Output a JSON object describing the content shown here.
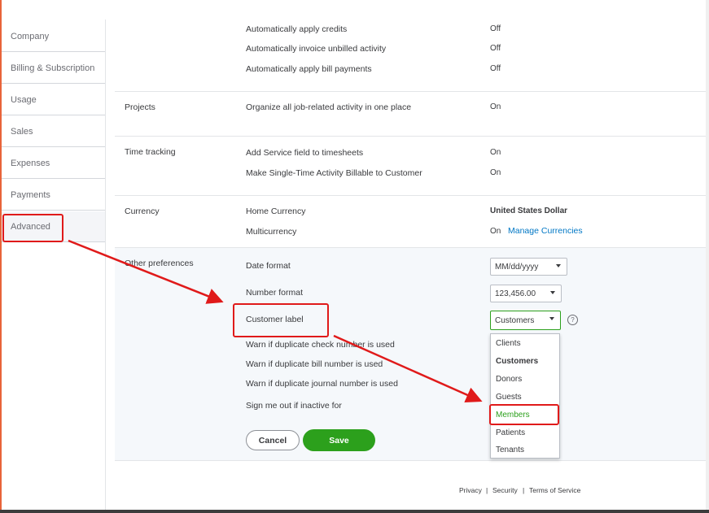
{
  "sidebar": {
    "items": [
      {
        "label": "Company"
      },
      {
        "label": "Billing & Subscription"
      },
      {
        "label": "Usage"
      },
      {
        "label": "Sales"
      },
      {
        "label": "Expenses"
      },
      {
        "label": "Payments"
      },
      {
        "label": "Advanced"
      }
    ]
  },
  "automation": {
    "rows": [
      {
        "label": "Automatically apply credits",
        "value": "Off"
      },
      {
        "label": "Automatically invoice unbilled activity",
        "value": "Off"
      },
      {
        "label": "Automatically apply bill payments",
        "value": "Off"
      }
    ]
  },
  "projects": {
    "title": "Projects",
    "rows": [
      {
        "label": "Organize all job-related activity in one place",
        "value": "On"
      }
    ]
  },
  "time_tracking": {
    "title": "Time tracking",
    "rows": [
      {
        "label": "Add Service field to timesheets",
        "value": "On"
      },
      {
        "label": "Make Single-Time Activity Billable to Customer",
        "value": "On"
      }
    ]
  },
  "currency": {
    "title": "Currency",
    "home_label": "Home Currency",
    "home_value": "United States Dollar",
    "multi_label": "Multicurrency",
    "multi_value": "On",
    "manage_link": "Manage Currencies"
  },
  "other": {
    "title": "Other preferences",
    "date_format_label": "Date format",
    "date_format_value": "MM/dd/yyyy",
    "number_format_label": "Number format",
    "number_format_value": "123,456.00",
    "customer_label_label": "Customer label",
    "customer_label_value": "Customers",
    "help_icon": "?",
    "warn_check": "Warn if duplicate check number is used",
    "warn_bill": "Warn if duplicate bill number is used",
    "warn_journal": "Warn if duplicate journal number is used",
    "sign_out": "Sign me out if inactive for",
    "dropdown_options": [
      "Clients",
      "Customers",
      "Donors",
      "Guests",
      "Members",
      "Patients",
      "Tenants"
    ]
  },
  "buttons": {
    "cancel": "Cancel",
    "save": "Save"
  },
  "footer": {
    "privacy": "Privacy",
    "sep1": "|",
    "security": "Security",
    "sep2": "|",
    "terms": "Terms of Service"
  },
  "colors": {
    "accent_green": "#2ca01c",
    "link_blue": "#0077c5",
    "annotation_red": "#e01a1a"
  }
}
